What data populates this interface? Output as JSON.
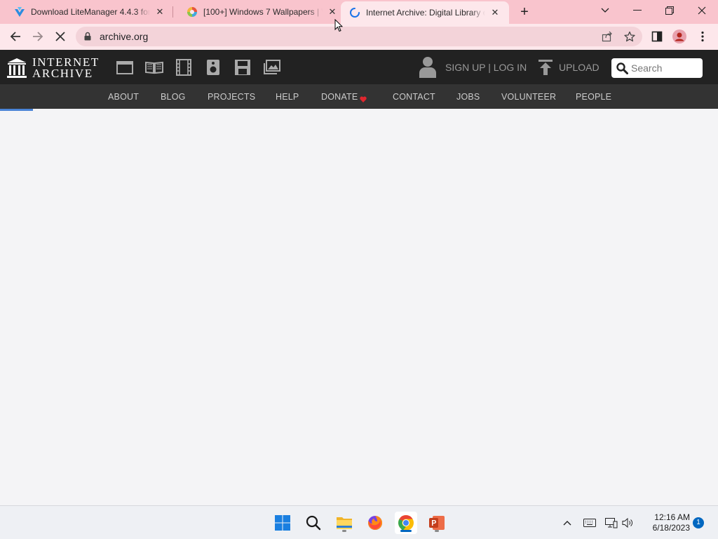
{
  "browser": {
    "tabs": [
      {
        "title": "Download LiteManager 4.4.3 for",
        "icon": "litemanager-icon"
      },
      {
        "title": "[100+] Windows 7 Wallpapers | W",
        "icon": "wallpapers-icon"
      },
      {
        "title": "Internet Archive: Digital Library o",
        "icon": "loading-spinner-icon",
        "active": true
      }
    ],
    "new_tab_label": "+",
    "url": "archive.org"
  },
  "ia": {
    "logo_line1": "INTERNET",
    "logo_line2": "ARCHIVE",
    "auth_text": "SIGN UP | LOG IN",
    "upload_text": "UPLOAD",
    "search_placeholder": "Search",
    "nav": [
      "ABOUT",
      "BLOG",
      "PROJECTS",
      "HELP",
      "DONATE",
      "CONTACT",
      "JOBS",
      "VOLUNTEER",
      "PEOPLE"
    ],
    "accent": "#4a84d6",
    "header_bg": "#222222",
    "nav_bg": "#333333"
  },
  "taskbar": {
    "apps": [
      "start-icon",
      "search-icon",
      "file-explorer-icon",
      "firefox-icon",
      "chrome-icon",
      "powerpoint-icon"
    ],
    "time": "12:16 AM",
    "date": "6/18/2023",
    "notification_count": "1"
  }
}
